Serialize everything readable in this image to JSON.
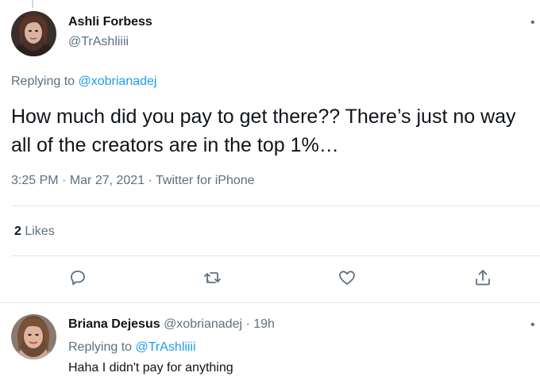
{
  "main_tweet": {
    "author_name": "Ashli Forbess",
    "author_handle": "@TrAshliiii",
    "replying_prefix": "Replying to ",
    "replying_to": "@xobrianadej",
    "text": "How much did you pay to get there?? There’s just no way all of the creators are in the top 1%…",
    "time": "3:25 PM",
    "sep1": " · ",
    "date": "Mar 27, 2021",
    "sep2": " · ",
    "source": "Twitter for iPhone",
    "likes_count": "2",
    "likes_label": " Likes",
    "more_icon": "•"
  },
  "actions": [
    {
      "name": "reply",
      "icon": "reply-icon"
    },
    {
      "name": "retweet",
      "icon": "retweet-icon"
    },
    {
      "name": "like",
      "icon": "heart-icon"
    },
    {
      "name": "share",
      "icon": "share-icon"
    }
  ],
  "reply_tweet": {
    "author_name": "Briana Dejesus",
    "author_handle": "@xobrianadej",
    "sep": " · ",
    "time": "19h",
    "replying_prefix": "Replying to ",
    "replying_to": "@TrAshliiii",
    "text": "Haha I didn't pay for anything",
    "more_icon": "•"
  },
  "colors": {
    "link": "#1d9bf0",
    "secondary": "#5b7083",
    "text": "#0f1419",
    "divider": "#e1e8ed"
  }
}
